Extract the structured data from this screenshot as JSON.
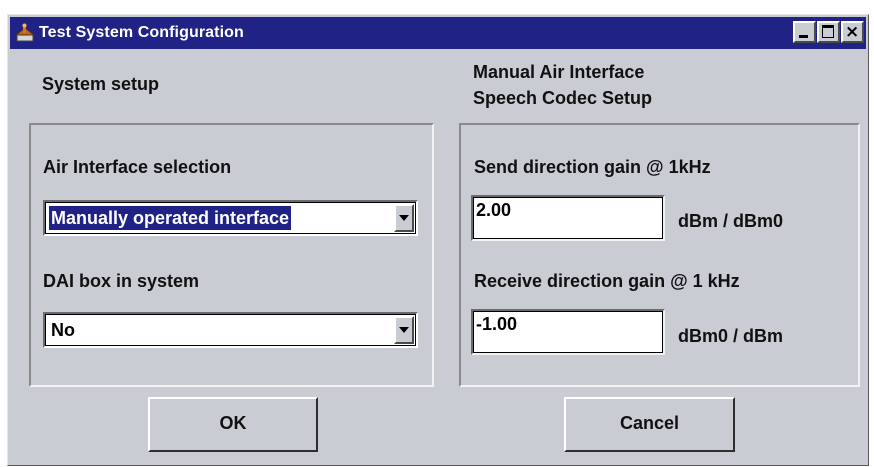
{
  "window": {
    "title": "Test System Configuration",
    "controls": {
      "minimize": "minimize",
      "maximize": "maximize",
      "close": "×"
    }
  },
  "left_panel": {
    "heading": "System setup",
    "air_interface_label": "Air Interface selection",
    "air_interface_value": "Manually operated interface",
    "dai_label": "DAI box in system",
    "dai_value": "No"
  },
  "right_panel": {
    "heading_line1": "Manual Air Interface",
    "heading_line2": "Speech Codec Setup",
    "send_label": "Send direction gain @ 1kHz",
    "send_value": "2.00",
    "send_unit": "dBm / dBm0",
    "receive_label": "Receive direction gain @ 1 kHz",
    "receive_value": "-1.00",
    "receive_unit": "dBm0 / dBm"
  },
  "buttons": {
    "ok": "OK",
    "cancel": "Cancel"
  },
  "colors": {
    "titlebar": "#202286",
    "face": "#c9ccd3",
    "selection": "#202286"
  }
}
